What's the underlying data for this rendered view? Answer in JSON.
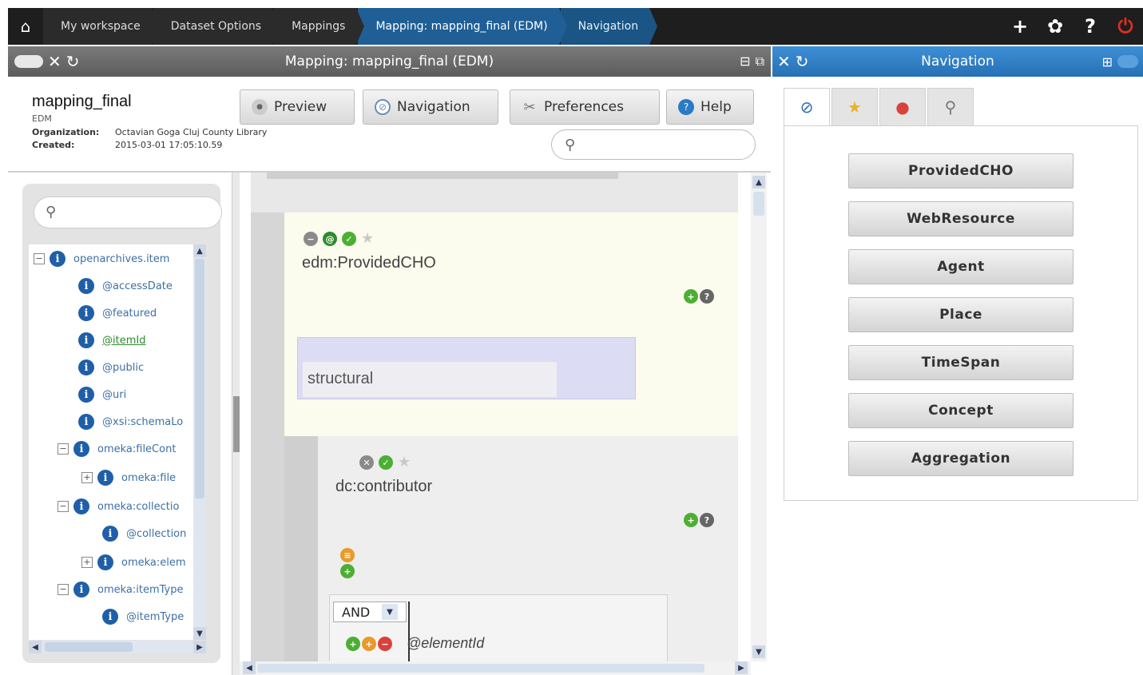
{
  "breadcrumb": {
    "items": [
      "My workspace",
      "Dataset Options",
      "Mappings",
      "Mapping: mapping_final (EDM)",
      "Navigation"
    ]
  },
  "top_actions": {
    "add": "+",
    "settings": "✿",
    "help": "?",
    "power": "⏻"
  },
  "left_panel": {
    "title": "Mapping: mapping_final (EDM)"
  },
  "right_panel": {
    "title": "Navigation"
  },
  "info": {
    "name": "mapping_final",
    "schema": "EDM",
    "organization_label": "Organization:",
    "organization_value": "Octavian Goga Cluj County Library",
    "created_label": "Created:",
    "created_value": "2015-03-01 17:05:10.59"
  },
  "toolbar": {
    "preview": "Preview",
    "navigation": "Navigation",
    "preferences": "Preferences",
    "help": "Help"
  },
  "tree": {
    "nodes": [
      {
        "label": "openarchives.item",
        "toggle": "−"
      },
      {
        "label": "@accessDate"
      },
      {
        "label": "@featured"
      },
      {
        "label": "@itemId"
      },
      {
        "label": "@public"
      },
      {
        "label": "@uri"
      },
      {
        "label": "@xsi:schemaLo"
      },
      {
        "label": "omeka:fileCont",
        "toggle": "−"
      },
      {
        "label": "omeka:file",
        "toggle": "+"
      },
      {
        "label": "omeka:collectio",
        "toggle": "−"
      },
      {
        "label": "@collection"
      },
      {
        "label": "omeka:elem",
        "toggle": "+"
      },
      {
        "label": "omeka:itemType",
        "toggle": "−"
      },
      {
        "label": "@itemType"
      }
    ]
  },
  "mapping": {
    "element1": "edm:ProvidedCHO",
    "structural": "structural",
    "element2": "dc:contributor",
    "condition_op": "AND",
    "condition_element": "@elementId"
  },
  "navigation": {
    "buttons": [
      "ProvidedCHO",
      "WebResource",
      "Agent",
      "Place",
      "TimeSpan",
      "Concept",
      "Aggregation"
    ]
  },
  "colors": {
    "topbar": "#1e1e1e",
    "active_crumb": "#1f5f96",
    "right_header": "#2770b4",
    "info_icon": "#1f5fa8"
  }
}
